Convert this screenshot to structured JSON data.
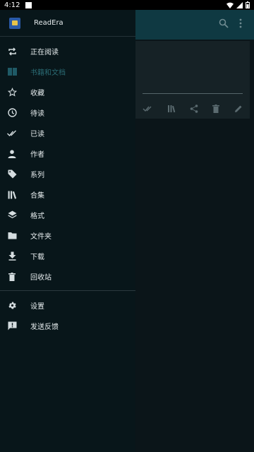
{
  "status_bar": {
    "time": "4:12"
  },
  "app": {
    "name": "ReadEra"
  },
  "menu": {
    "items": [
      {
        "label": "正在阅读",
        "icon": "repeat-icon"
      },
      {
        "label": "书籍和文档",
        "icon": "book-icon",
        "active": true
      },
      {
        "label": "收藏",
        "icon": "star-icon"
      },
      {
        "label": "待读",
        "icon": "clock-icon"
      },
      {
        "label": "已读",
        "icon": "double-check-icon"
      },
      {
        "label": "作者",
        "icon": "person-icon"
      },
      {
        "label": "系列",
        "icon": "tag-icon"
      },
      {
        "label": "合集",
        "icon": "books-icon"
      },
      {
        "label": "格式",
        "icon": "layers-icon"
      },
      {
        "label": "文件夹",
        "icon": "folder-icon"
      },
      {
        "label": "下载",
        "icon": "download-icon"
      },
      {
        "label": "回收站",
        "icon": "trash-icon"
      }
    ],
    "bottom_items": [
      {
        "label": "设置",
        "icon": "gear-icon"
      },
      {
        "label": "发送反馈",
        "icon": "feedback-icon"
      }
    ]
  },
  "colors": {
    "drawer_bg": "#08161a",
    "appbar_bg": "#0f3942",
    "active_text": "#2a6a73"
  }
}
